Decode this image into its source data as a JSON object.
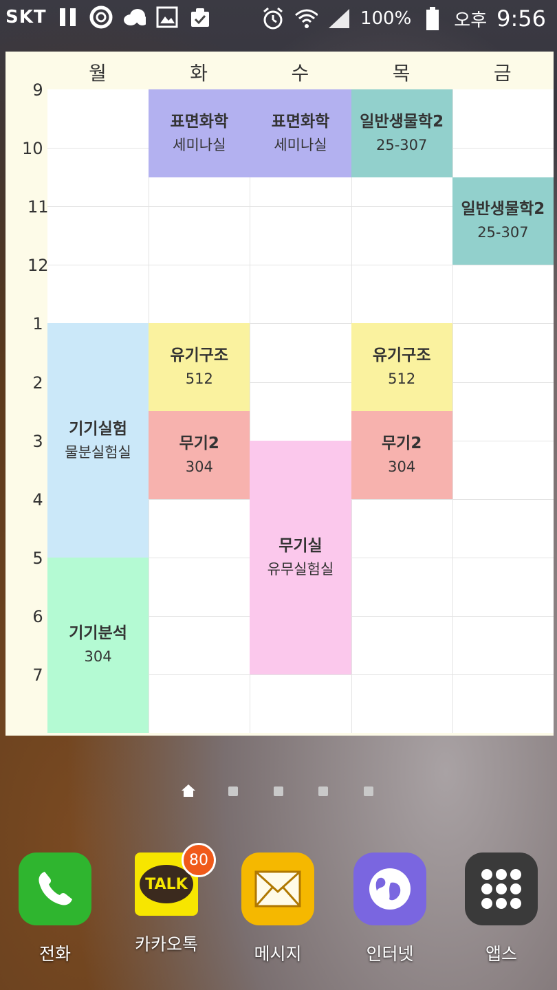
{
  "status_bar": {
    "carrier": "SKT",
    "battery": "100%",
    "ampm": "오후",
    "time": "9:56",
    "icons_left": [
      "pause-icon",
      "camera-aperture-icon",
      "cloud-icon",
      "gallery-icon",
      "clipboard-check-icon"
    ],
    "icons_right": [
      "alarm-icon",
      "wifi-icon",
      "signal-icon",
      "battery-icon"
    ]
  },
  "timetable": {
    "days": [
      "월",
      "화",
      "수",
      "목",
      "금"
    ],
    "hours": [
      "9",
      "10",
      "11",
      "12",
      "1",
      "2",
      "3",
      "4",
      "5",
      "6",
      "7"
    ],
    "colors": {
      "purple": "#b3b1f0",
      "teal": "#92d0cc",
      "light_blue": "#cbe8f9",
      "yellow": "#faf29f",
      "salmon": "#f7b2ae",
      "pink": "#fbc8ec",
      "mint": "#b4fad3"
    },
    "classes": [
      {
        "day": 1,
        "start": 0,
        "end": 1.5,
        "name": "표면화학",
        "room": "세미나실",
        "color": "#b3b1f0"
      },
      {
        "day": 2,
        "start": 0,
        "end": 1.5,
        "name": "표면화학",
        "room": "세미나실",
        "color": "#b3b1f0"
      },
      {
        "day": 3,
        "start": 0,
        "end": 1.5,
        "name": "일반생물학2",
        "room": "25-307",
        "color": "#92d0cc"
      },
      {
        "day": 4,
        "start": 1.5,
        "end": 3,
        "name": "일반생물학2",
        "room": "25-307",
        "color": "#92d0cc"
      },
      {
        "day": 0,
        "start": 4,
        "end": 8,
        "name": "기기실험",
        "room": "물분실험실",
        "color": "#cbe8f9"
      },
      {
        "day": 1,
        "start": 4,
        "end": 5.5,
        "name": "유기구조",
        "room": "512",
        "color": "#faf29f"
      },
      {
        "day": 3,
        "start": 4,
        "end": 5.5,
        "name": "유기구조",
        "room": "512",
        "color": "#faf29f"
      },
      {
        "day": 1,
        "start": 5.5,
        "end": 7,
        "name": "무기2",
        "room": "304",
        "color": "#f7b2ae"
      },
      {
        "day": 3,
        "start": 5.5,
        "end": 7,
        "name": "무기2",
        "room": "304",
        "color": "#f7b2ae"
      },
      {
        "day": 2,
        "start": 6,
        "end": 10,
        "name": "무기실",
        "room": "유무실험실",
        "color": "#fbc8ec"
      },
      {
        "day": 0,
        "start": 8,
        "end": 11,
        "name": "기기분석",
        "room": "304",
        "color": "#b4fad3"
      }
    ]
  },
  "pager": {
    "pages": 5,
    "current": 0
  },
  "dock": [
    {
      "label": "전화",
      "icon": "phone-icon",
      "color": "#2fb52f"
    },
    {
      "label": "카카오톡",
      "icon": "kakaotalk-icon",
      "color": "#f7e600",
      "badge": "80",
      "icon_text": "TALK"
    },
    {
      "label": "메시지",
      "icon": "envelope-icon",
      "color": "#f5b800"
    },
    {
      "label": "인터넷",
      "icon": "globe-icon",
      "color": "#7a66e0"
    },
    {
      "label": "앱스",
      "icon": "apps-grid-icon",
      "color": "#3a3a3a"
    }
  ]
}
